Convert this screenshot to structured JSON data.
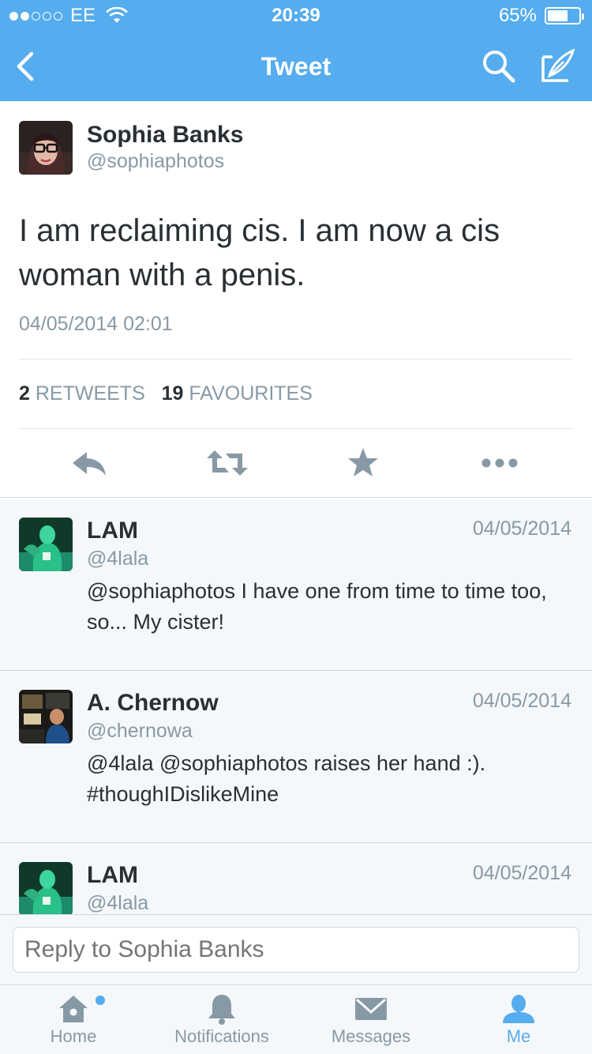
{
  "status_bar": {
    "carrier": "EE",
    "time": "20:39",
    "battery_text": "65%",
    "battery_level": 0.65
  },
  "nav": {
    "title": "Tweet"
  },
  "tweet": {
    "name": "Sophia Banks",
    "handle": "@sophiaphotos",
    "text": "I am reclaiming cis. I am now a cis woman with a penis.",
    "timestamp": "04/05/2014 02:01",
    "retweets_count": "2",
    "retweets_label": "RETWEETS",
    "favourites_count": "19",
    "favourites_label": "FAVOURITES"
  },
  "replies": [
    {
      "name": "LAM",
      "handle": "@4lala",
      "date": "04/05/2014",
      "text": "@sophiaphotos I have one from time to time too, so... My cister!"
    },
    {
      "name": "A. Chernow",
      "handle": "@chernowa",
      "date": "04/05/2014",
      "text": "@4lala @sophiaphotos raises her hand :). #thoughIDislikeMine"
    },
    {
      "name": "LAM",
      "handle": "@4lala",
      "date": "04/05/2014",
      "text": ""
    }
  ],
  "composer": {
    "placeholder": "Reply to Sophia Banks"
  },
  "tabs": [
    {
      "label": "Home"
    },
    {
      "label": "Notifications"
    },
    {
      "label": "Messages"
    },
    {
      "label": "Me"
    }
  ],
  "colors": {
    "brand": "#55acee",
    "text": "#292f33",
    "muted": "#8899a6",
    "border": "#ccd6dd"
  }
}
